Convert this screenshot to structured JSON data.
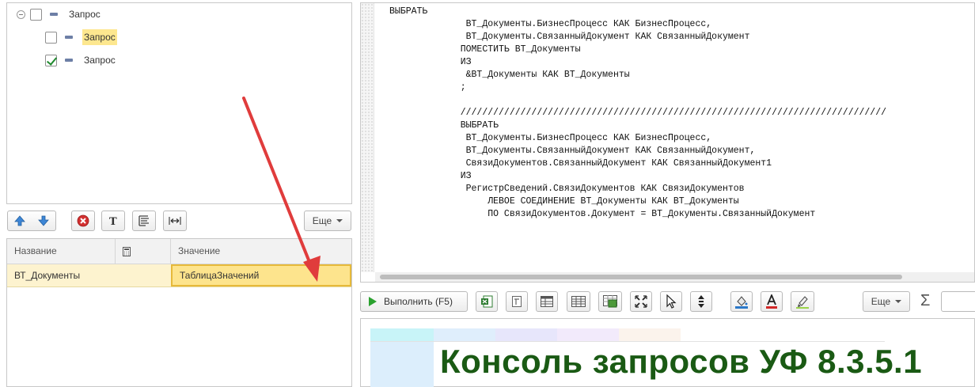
{
  "tree": {
    "root": {
      "label": "Запрос",
      "checked": false
    },
    "children": [
      {
        "label": "Запрос",
        "checked": false,
        "highlighted": true
      },
      {
        "label": "Запрос",
        "checked": true,
        "highlighted": false
      }
    ]
  },
  "left_toolbar": {
    "icons": [
      "move-up-icon",
      "move-down-icon",
      "delete-icon",
      "text-icon",
      "query-wizard-icon",
      "expand-width-icon"
    ],
    "more_label": "Еще"
  },
  "params_table": {
    "columns": [
      "Название",
      "",
      "Значение"
    ],
    "rows": [
      {
        "name": "ВТ_Документы",
        "value": "ТаблицаЗначений"
      }
    ]
  },
  "code_editor": {
    "lines": [
      "ВЫБРАТЬ",
      "              ВТ_Документы.БизнесПроцесс КАК БизнесПроцесс,",
      "              ВТ_Документы.СвязанныйДокумент КАК СвязанныйДокумент",
      "             ПОМЕСТИТЬ ВТ_Документы",
      "             ИЗ",
      "              &ВТ_Документы КАК ВТ_Документы",
      "             ;",
      "",
      "             //////////////////////////////////////////////////////////////////////////////",
      "             ВЫБРАТЬ",
      "              ВТ_Документы.БизнесПроцесс КАК БизнесПроцесс,",
      "              ВТ_Документы.СвязанныйДокумент КАК СвязанныйДокумент,",
      "              СвязиДокументов.СвязанныйДокумент КАК СвязанныйДокумент1",
      "             ИЗ",
      "              РегистрСведений.СвязиДокументов КАК СвязиДокументов",
      "                  ЛЕВОЕ СОЕДИНЕНИЕ ВТ_Документы КАК ВТ_Документы",
      "                  ПО СвязиДокументов.Документ = ВТ_Документы.СвязанныйДокумент"
    ]
  },
  "bottom_toolbar": {
    "run_label": "Выполнить (F5)",
    "icons": [
      "excel-icon",
      "text-doc-icon",
      "table-icon",
      "grid-icon",
      "spreadsheet-image-icon",
      "fit-icon",
      "cursor-icon",
      "vertical-arrows-icon",
      "fill-color-icon",
      "font-color-icon",
      "highlighter-icon"
    ],
    "more_label": "Еще",
    "sum_label": "Σ"
  },
  "result": {
    "watermark": "Консоль запросов УФ 8.3.5.1"
  },
  "colors": {
    "highlight": "#fde78f",
    "arrow": "#e03c3c",
    "watermark": "#1a5a14"
  }
}
